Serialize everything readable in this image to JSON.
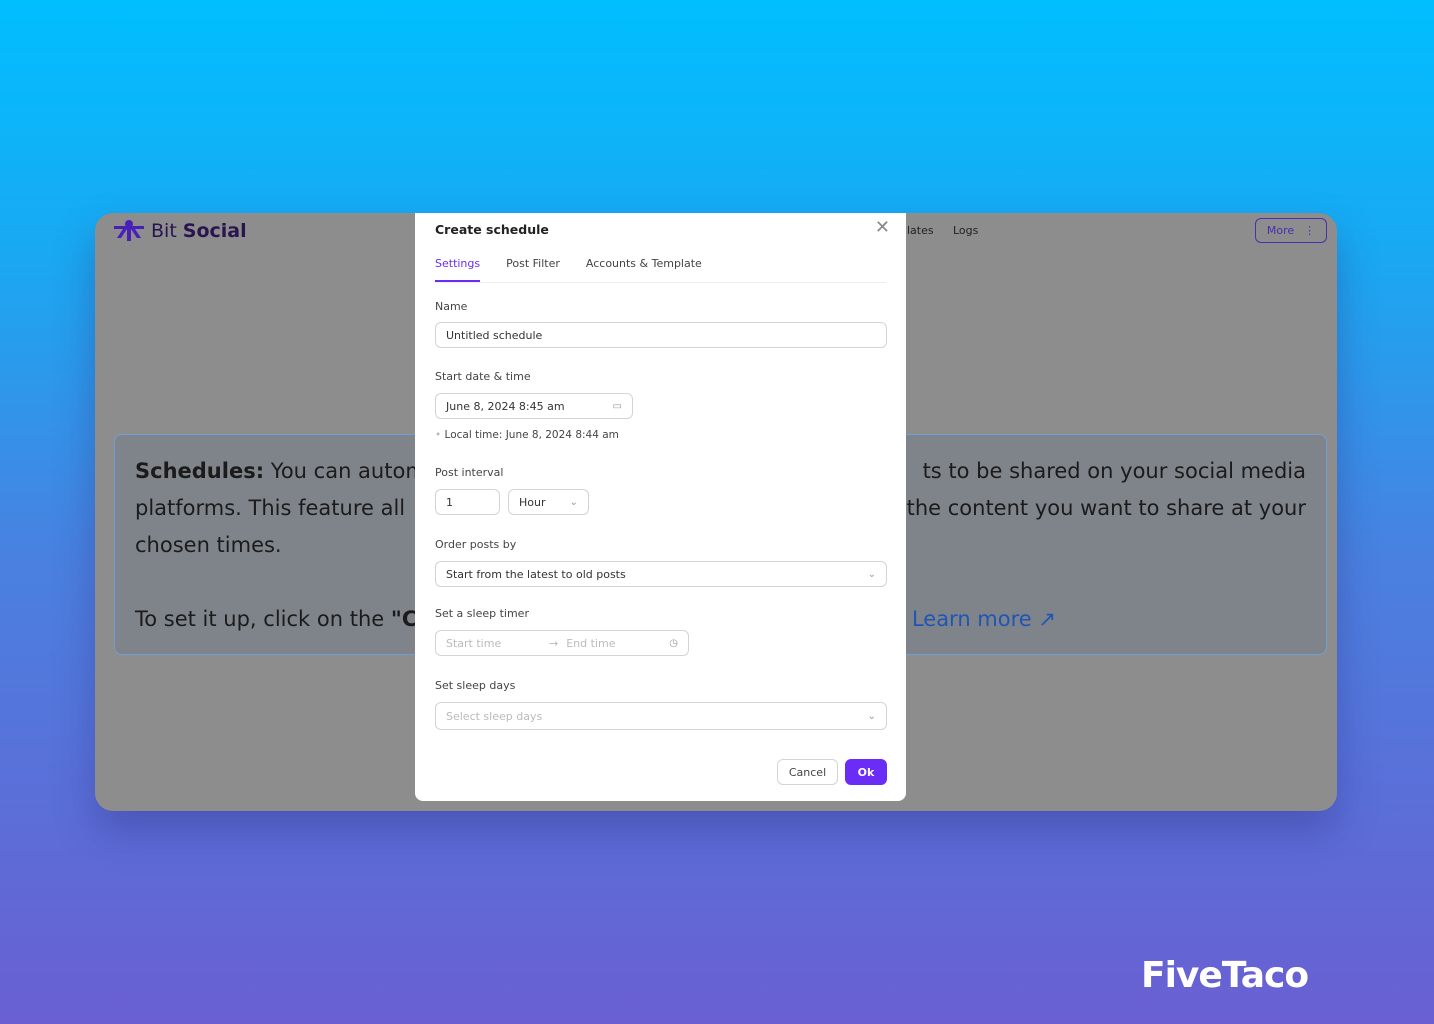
{
  "app": {
    "brand_light": "Bit",
    "brand_bold": "Social",
    "nav": [
      "lates",
      "Logs"
    ],
    "more_label": "More"
  },
  "info": {
    "bold": "Schedules:",
    "line1_left": "You can autom",
    "line1_right": "ts to be shared on your social media",
    "line2_left": "platforms. This feature all",
    "line2_right": "the content you want to share at your",
    "line3": "chosen times.",
    "setup_left": "To set it up, click on the",
    "setup_bold": "\"Cr",
    "learn_more": "Learn more"
  },
  "modal": {
    "title": "Create schedule",
    "tabs": [
      {
        "label": "Settings",
        "active": true
      },
      {
        "label": "Post Filter"
      },
      {
        "label": "Accounts & Template"
      }
    ],
    "name_label": "Name",
    "name_value": "Untitled schedule",
    "start_label": "Start date & time",
    "start_value": "June 8, 2024 8:45 am",
    "local_time": "Local time: June 8, 2024 8:44 am",
    "interval_label": "Post interval",
    "interval_value": "1",
    "interval_unit": "Hour",
    "order_label": "Order posts by",
    "order_value": "Start from the latest to old posts",
    "sleep_timer_label": "Set a sleep timer",
    "start_time_ph": "Start time",
    "end_time_ph": "End time",
    "sleep_days_label": "Set sleep days",
    "sleep_days_ph": "Select sleep days",
    "cancel": "Cancel",
    "ok": "Ok"
  },
  "colors": {
    "accent": "#6b2cf5",
    "link": "#1f55b5"
  },
  "watermark": "FiveTaco"
}
